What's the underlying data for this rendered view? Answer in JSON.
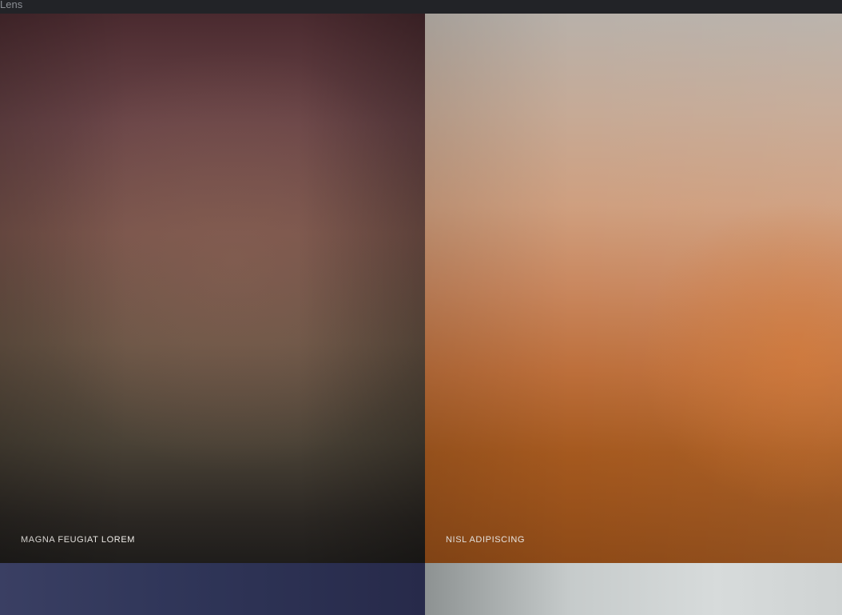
{
  "app": {
    "title": "Lens"
  },
  "gallery": {
    "tiles": [
      {
        "caption": "MAGNA FEUGIAT LOREM"
      },
      {
        "caption": "NISL ADIPISCING"
      },
      {
        "caption": ""
      },
      {
        "caption": ""
      }
    ]
  }
}
